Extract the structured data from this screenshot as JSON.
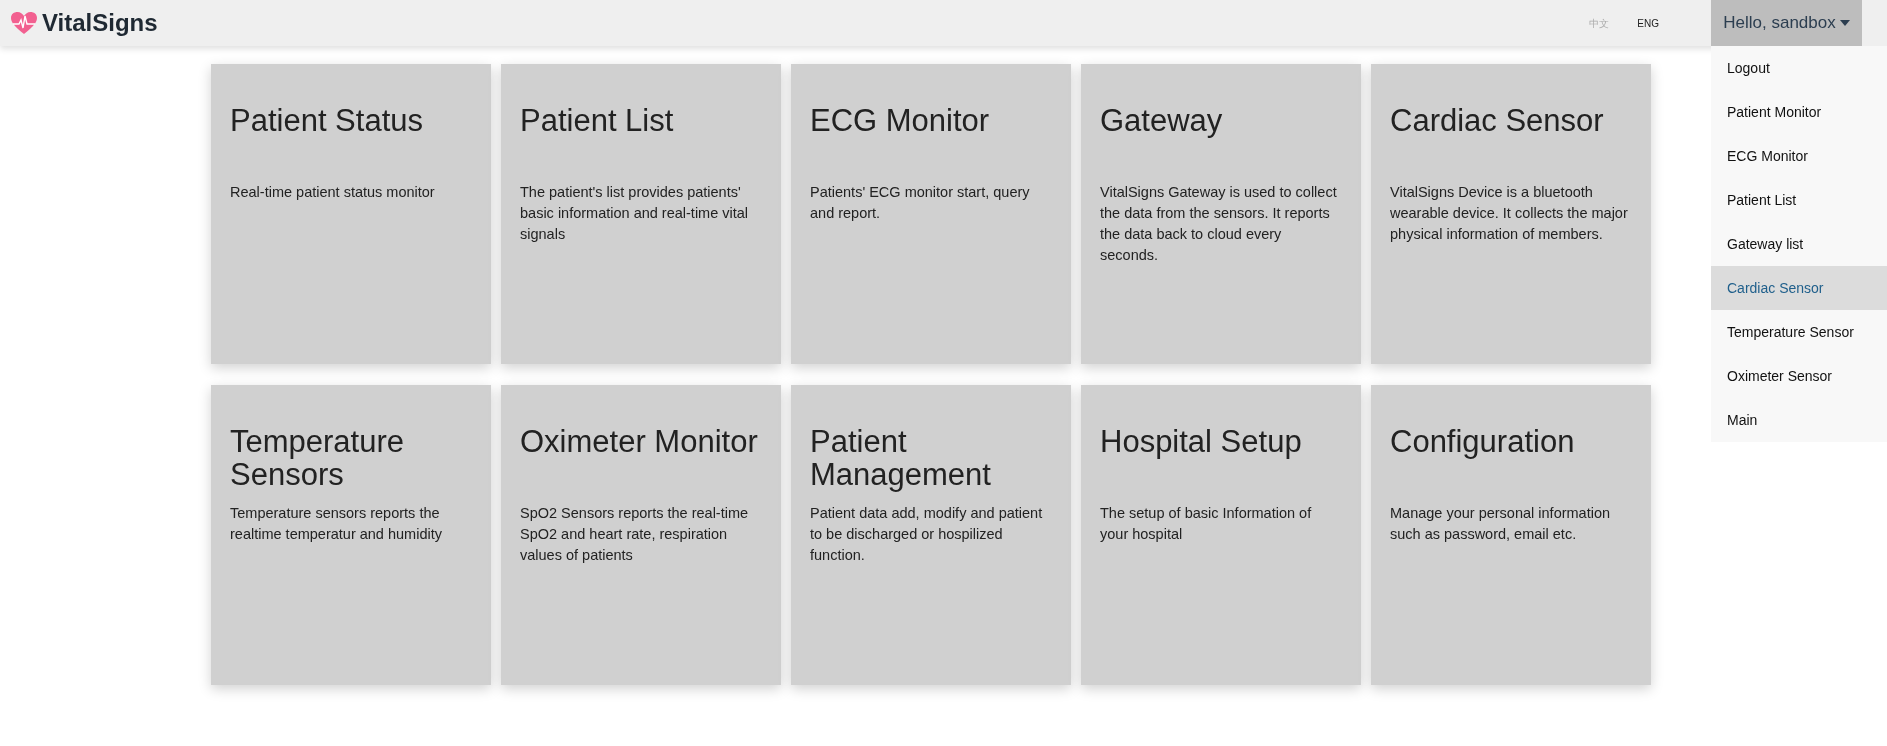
{
  "header": {
    "brand": "VitalSigns",
    "languages": [
      {
        "label": "中文",
        "selected": false
      },
      {
        "label": "ENG",
        "selected": true
      }
    ],
    "user_menu": {
      "label": "Hello, sandbox",
      "expanded": true
    }
  },
  "menu_items": [
    {
      "label": "Logout",
      "selected": false
    },
    {
      "label": "Patient Monitor",
      "selected": false
    },
    {
      "label": "ECG Monitor",
      "selected": false
    },
    {
      "label": "Patient List",
      "selected": false
    },
    {
      "label": "Gateway list",
      "selected": false
    },
    {
      "label": "Cardiac Sensor",
      "selected": true
    },
    {
      "label": "Temperature Sensor",
      "selected": false
    },
    {
      "label": "Oximeter Sensor",
      "selected": false
    },
    {
      "label": "Main",
      "selected": false
    }
  ],
  "cards": [
    {
      "title": "Patient Status",
      "description": "Real-time patient status monitor"
    },
    {
      "title": "Patient List",
      "description": "The patient's list provides patients' basic information and real-time vital signals"
    },
    {
      "title": "ECG Monitor",
      "description": "Patients' ECG monitor start, query and report."
    },
    {
      "title": "Gateway",
      "description": "VitalSigns Gateway is used to collect the data from the sensors. It reports the data back to cloud every seconds."
    },
    {
      "title": "Cardiac Sensor",
      "description": "VitalSigns Device is a bluetooth wearable device. It collects the major physical information of members."
    },
    {
      "title": "Temperature Sensors",
      "description": "Temperature sensors reports the realtime temperatur and humidity"
    },
    {
      "title": "Oximeter Monitor",
      "description": "SpO2 Sensors reports the real-time SpO2 and heart rate, respiration values of patients"
    },
    {
      "title": "Patient Management",
      "description": "Patient data add, modify and patient to be discharged or hospilized function."
    },
    {
      "title": "Hospital Setup",
      "description": "The setup of basic Information of your hospital"
    },
    {
      "title": "Configuration",
      "description": "Manage your personal information such as password, email etc."
    }
  ]
}
